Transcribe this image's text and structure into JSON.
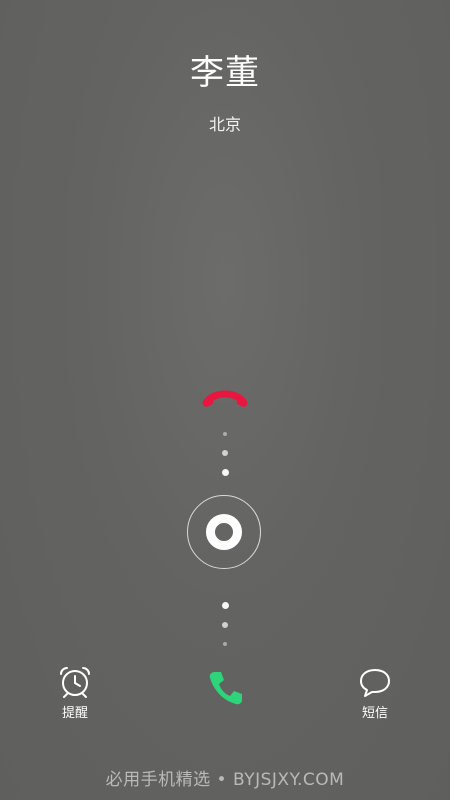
{
  "caller": {
    "name": "李董",
    "location": "北京"
  },
  "actions": {
    "decline_icon": "hang-up-icon",
    "slider_icon": "ring-knob",
    "answer_icon": "phone-icon",
    "remind": {
      "label": "提醒",
      "icon": "alarm-clock-icon"
    },
    "message": {
      "label": "短信",
      "icon": "speech-bubble-icon"
    }
  },
  "watermark": "必用手机精选 • BYJSJXY.COM",
  "colors": {
    "background": "#616160",
    "decline": "#e8173f",
    "answer": "#2ed47a",
    "text": "#ffffff"
  }
}
